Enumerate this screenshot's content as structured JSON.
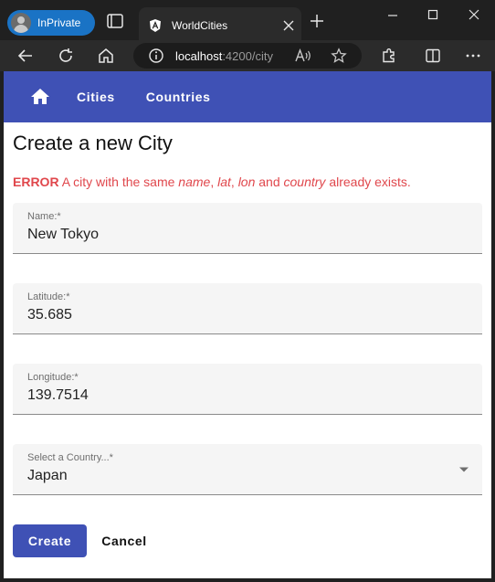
{
  "browser": {
    "profile_label": "InPrivate",
    "tab": {
      "title": "WorldCities"
    },
    "url": {
      "host": "localhost",
      "path": ":4200/city"
    },
    "icons": {
      "profile": "profile-avatar-icon",
      "tab_actions": "tab-actions-icon",
      "favicon": "angular-icon",
      "close_tab": "close-icon",
      "new_tab": "plus-icon",
      "minimize": "minimize-icon",
      "maximize": "maximize-icon",
      "close_window": "close-icon",
      "back": "back-arrow-icon",
      "refresh": "refresh-icon",
      "home": "home-icon",
      "site_info": "info-icon",
      "read_aloud": "read-aloud-icon",
      "favorite": "star-icon",
      "extensions": "puzzle-icon",
      "split_screen": "split-screen-icon",
      "more": "more-icon"
    }
  },
  "app": {
    "nav": {
      "home_icon": "home-icon",
      "cities": "Cities",
      "countries": "Countries"
    },
    "title": "Create a new City",
    "error": {
      "label": "ERROR",
      "before": "A city with the same",
      "name": "name",
      "comma1": ",",
      "lat": "lat",
      "comma2": ",",
      "lon": "lon",
      "and": "and",
      "country": "country",
      "after": "already exists."
    },
    "form": {
      "name": {
        "label": "Name:*",
        "value": "New Tokyo"
      },
      "latitude": {
        "label": "Latitude:*",
        "value": "35.685"
      },
      "longitude": {
        "label": "Longitude:*",
        "value": "139.7514"
      },
      "country": {
        "label": "Select a Country...*",
        "value": "Japan"
      }
    },
    "actions": {
      "create": "Create",
      "cancel": "Cancel"
    }
  },
  "colors": {
    "primary": "#3f51b5",
    "error": "#e0474c",
    "field_bg": "#f5f5f5",
    "chrome_bg": "#202020"
  }
}
